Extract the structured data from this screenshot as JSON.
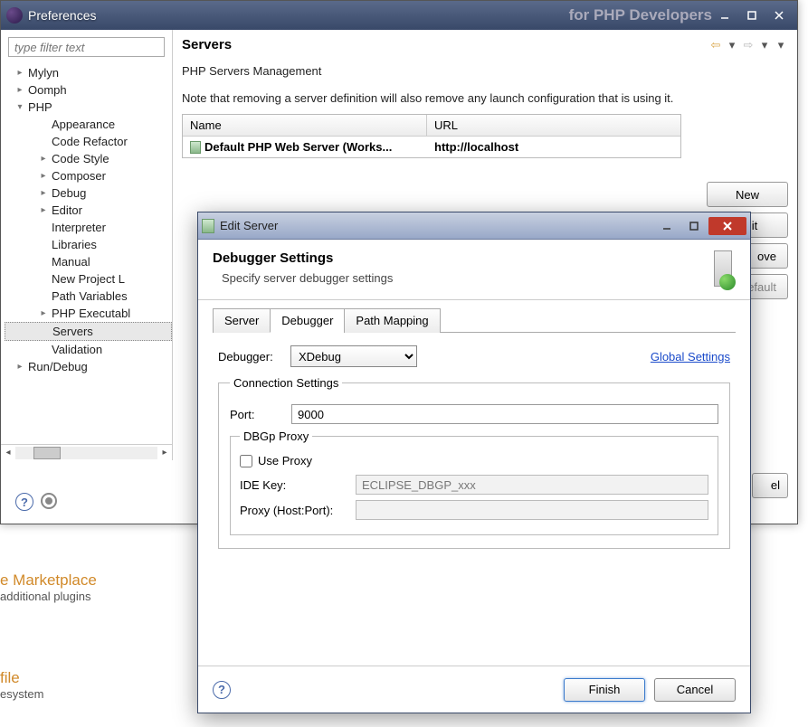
{
  "mainWindow": {
    "title": "Preferences",
    "fadedTitle": "for PHP Developers"
  },
  "sidebar": {
    "filterPlaceholder": "type filter text",
    "items": [
      {
        "label": "Mylyn",
        "level": 1,
        "arrow": "right"
      },
      {
        "label": "Oomph",
        "level": 1,
        "arrow": "right"
      },
      {
        "label": "PHP",
        "level": 1,
        "arrow": "down"
      },
      {
        "label": "Appearance",
        "level": 2
      },
      {
        "label": "Code Refactor",
        "level": 2
      },
      {
        "label": "Code Style",
        "level": 2,
        "arrow": "right"
      },
      {
        "label": "Composer",
        "level": 2,
        "arrow": "right"
      },
      {
        "label": "Debug",
        "level": 2,
        "arrow": "right"
      },
      {
        "label": "Editor",
        "level": 2,
        "arrow": "right"
      },
      {
        "label": "Interpreter",
        "level": 2
      },
      {
        "label": "Libraries",
        "level": 2
      },
      {
        "label": "Manual",
        "level": 2
      },
      {
        "label": "New Project L",
        "level": 2
      },
      {
        "label": "Path Variables",
        "level": 2
      },
      {
        "label": "PHP Executabl",
        "level": 2,
        "arrow": "right"
      },
      {
        "label": "Servers",
        "level": 2,
        "selected": true
      },
      {
        "label": "Validation",
        "level": 2
      },
      {
        "label": "Run/Debug",
        "level": 1,
        "arrow": "right"
      }
    ]
  },
  "rightPane": {
    "heading": "Servers",
    "desc": "PHP Servers Management",
    "note": "Note that removing a server definition will also remove any launch configuration that is using it.",
    "table": {
      "colName": "Name",
      "colUrl": "URL",
      "rowName": "Default PHP Web Server (Works...",
      "rowUrl": "http://localhost"
    },
    "buttons": {
      "new": "New",
      "edit": "Edit",
      "ove": "ove",
      "efault": "efault"
    },
    "partialBtn": "el"
  },
  "dialog": {
    "title": "Edit Server",
    "headerTitle": "Debugger Settings",
    "headerSub": "Specify server debugger settings",
    "tabs": {
      "server": "Server",
      "debugger": "Debugger",
      "pathmap": "Path Mapping"
    },
    "debuggerLabel": "Debugger:",
    "debuggerValue": "XDebug",
    "globalLink": "Global Settings",
    "connLegend": "Connection Settings",
    "portLabel": "Port:",
    "portValue": "9000",
    "proxyLegend": "DBGp Proxy",
    "useProxy": "Use Proxy",
    "ideKeyLabel": "IDE Key:",
    "ideKeyValue": "ECLIPSE_DBGP_xxx",
    "proxyHostLabel": "Proxy (Host:Port):",
    "proxyHostValue": "",
    "finish": "Finish",
    "cancel": "Cancel"
  },
  "bg": {
    "marketHead": "e Marketplace",
    "marketSub": " additional plugins",
    "fileHead": "file",
    "fileSub": "esystem"
  }
}
